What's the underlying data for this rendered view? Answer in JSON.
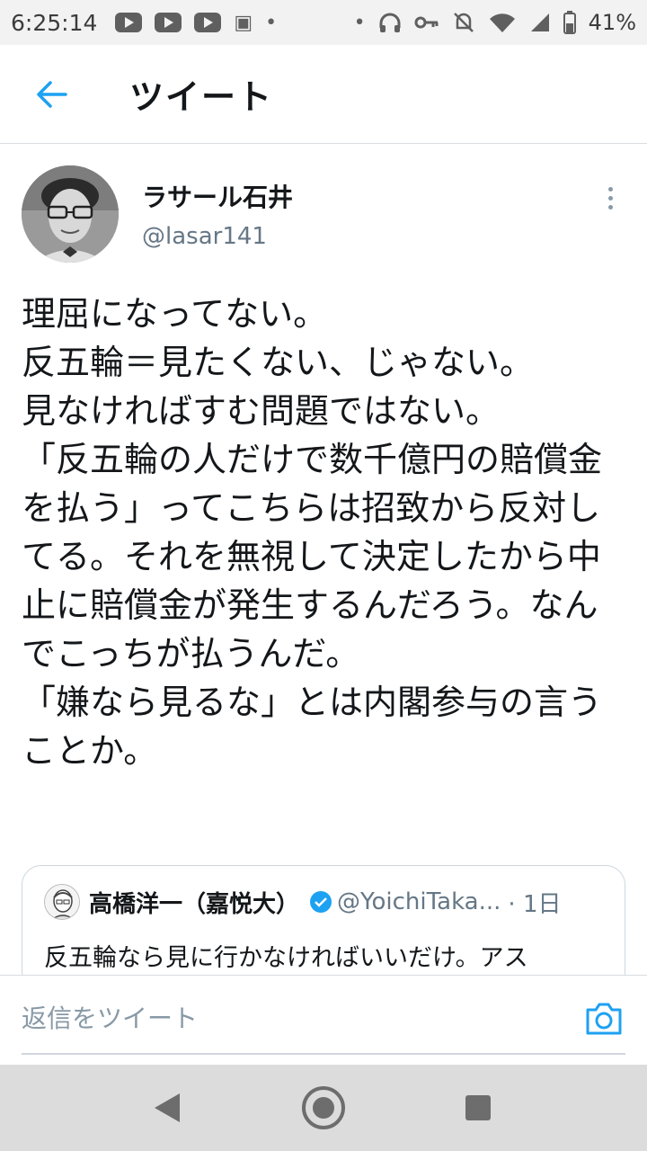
{
  "status_bar": {
    "time": "6:25:14",
    "battery": "41%"
  },
  "header": {
    "title": "ツイート",
    "back_icon": "back-arrow-icon"
  },
  "tweet": {
    "display_name": "ラサール石井",
    "handle": "@lasar141",
    "text": "理屈になってない。\n反五輪＝見たくない、じゃない。\n見なければすむ問題ではない。\n「反五輪の人だけで数千億円の賠償金を払う」ってこちらは招致から反対してる。それを無視して決定したから中止に賠償金が発生するんだろう。なんでこっちが払うんだ。\n「嫌なら見るな」とは内閣参与の言うことか。"
  },
  "quoted_tweet": {
    "display_name": "高橋洋一（嘉悦大）",
    "handle": "@YoichiTaka...",
    "time": "· 1日",
    "text": "反五輪なら見に行かなければいいだけ。アス"
  },
  "reply": {
    "placeholder": "返信をツイート"
  },
  "colors": {
    "accent": "#1da1f2",
    "text": "#14171a",
    "secondary": "#657786"
  }
}
